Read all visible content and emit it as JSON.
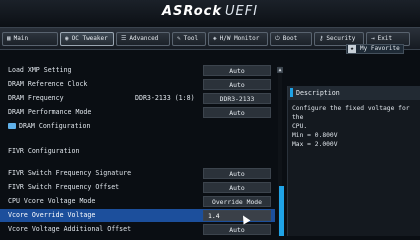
{
  "header": {
    "brand": "ASRock",
    "product": "UEFI"
  },
  "tabs": [
    {
      "icon": "main-icon",
      "glyph": "▦",
      "label": "Main"
    },
    {
      "icon": "oc-tweaker-icon",
      "glyph": "◉",
      "label": "OC Tweaker"
    },
    {
      "icon": "advanced-icon",
      "glyph": "☰",
      "label": "Advanced"
    },
    {
      "icon": "tool-icon",
      "glyph": "✎",
      "label": "Tool"
    },
    {
      "icon": "hw-monitor-icon",
      "glyph": "◈",
      "label": "H/W Monitor"
    },
    {
      "icon": "boot-icon",
      "glyph": "⏻",
      "label": "Boot"
    },
    {
      "icon": "security-icon",
      "glyph": "⚷",
      "label": "Security"
    },
    {
      "icon": "exit-icon",
      "glyph": "⇥",
      "label": "Exit"
    }
  ],
  "favorite": {
    "label": "My Favorite"
  },
  "settings": [
    {
      "label": "Load XMP Setting",
      "value": "Auto"
    },
    {
      "label": "DRAM Reference Clock",
      "value": "Auto"
    },
    {
      "label": "DRAM Frequency",
      "current": "DDR3-2133 (1:8)",
      "value": "DDR3-2133"
    },
    {
      "label": "DRAM Performance Mode",
      "value": "Auto"
    }
  ],
  "dram_config": {
    "label": "DRAM Configuration"
  },
  "fivr_section": {
    "label": "FIVR Configuration"
  },
  "fivr_settings": [
    {
      "label": "FIVR Switch Frequency Signature",
      "value": "Auto"
    },
    {
      "label": "FIVR Switch Frequency Offset",
      "value": "Auto"
    },
    {
      "label": "CPU Vcore Voltage Mode",
      "value": "Override Mode"
    },
    {
      "label": "Vcore Override Voltage",
      "value": "1.4"
    },
    {
      "label": "Vcore Voltage Additional Offset",
      "value": "Auto"
    }
  ],
  "description": {
    "title": "Description",
    "line1": "Configure the fixed voltage for the",
    "line2": "CPU.",
    "line3": "Min = 0.800V",
    "line4": "Max = 2.000V"
  }
}
